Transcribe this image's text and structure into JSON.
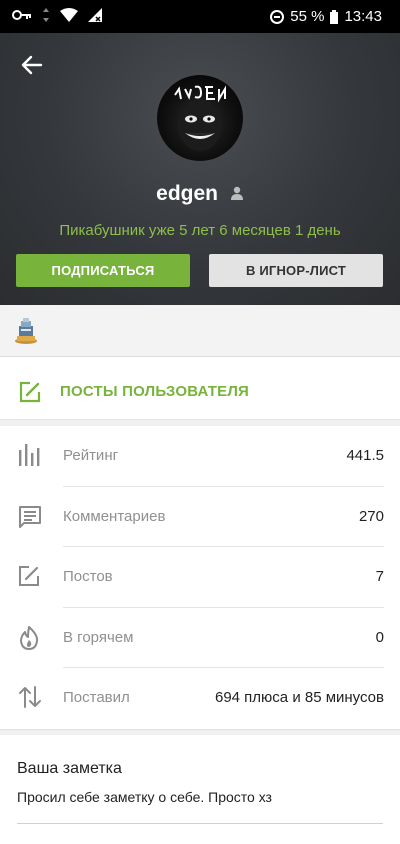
{
  "status_bar": {
    "battery_percent": "55 %",
    "time": "13:43"
  },
  "profile": {
    "username": "edgen",
    "tenure": "Пикабушник уже 5 лет 6 месяцев 1 день",
    "subscribe_label": "ПОДПИСАТЬСЯ",
    "ignore_label": "В ИГНОР-ЛИСТ"
  },
  "posts_link": {
    "label": "ПОСТЫ ПОЛЬЗОВАТЕЛЯ"
  },
  "stats": [
    {
      "icon": "bar-chart-icon",
      "label": "Рейтинг",
      "value": "441.5"
    },
    {
      "icon": "comment-icon",
      "label": "Комментариев",
      "value": "270"
    },
    {
      "icon": "edit-icon",
      "label": "Постов",
      "value": "7"
    },
    {
      "icon": "flame-icon",
      "label": "В горячем",
      "value": "0"
    },
    {
      "icon": "arrows-updown-icon",
      "label": "Поставил",
      "value": "694 плюса и 85 минусов"
    }
  ],
  "note": {
    "title": "Ваша заметка",
    "text": "Просил себе заметку о себе. Просто хз"
  },
  "colors": {
    "accent_green": "#78b33c",
    "header_bg": "#34373b"
  }
}
